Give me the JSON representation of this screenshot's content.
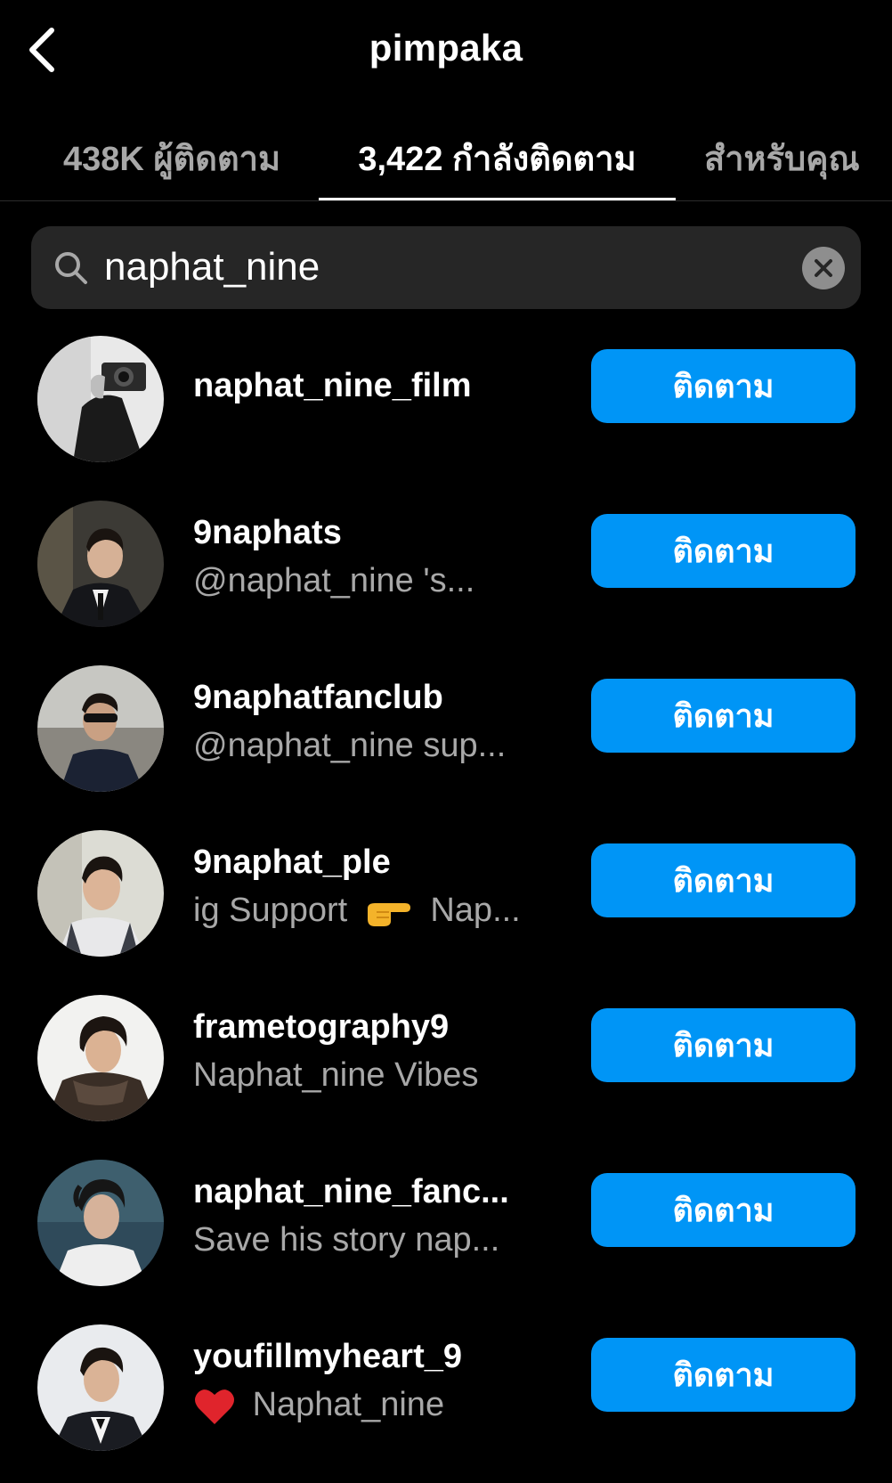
{
  "header": {
    "title": "pimpaka",
    "back_icon": "chevron-left-icon"
  },
  "tabs": [
    {
      "label": "438K ผู้ติดตาม",
      "active": false
    },
    {
      "label": "3,422 กำลังติดตาม",
      "active": true
    },
    {
      "label": "สำหรับคุณ",
      "active": false
    }
  ],
  "search": {
    "value": "naphat_nine",
    "icon": "search-icon",
    "clear_icon": "clear-icon"
  },
  "results": [
    {
      "username": "naphat_nine_film",
      "subtitle": "",
      "button": "ติดตาม"
    },
    {
      "username": "9naphats",
      "subtitle": "@naphat_nine 's...",
      "button": "ติดตาม"
    },
    {
      "username": "9naphatfanclub",
      "subtitle": "@naphat_nine sup...",
      "button": "ติดตาม"
    },
    {
      "username": "9naphat_ple",
      "subtitle_prefix": "ig Support",
      "subtitle_emoji": "pointing-right-hand-icon",
      "subtitle_suffix": "Nap...",
      "button": "ติดตาม"
    },
    {
      "username": "frametography9",
      "subtitle": "Naphat_nine Vibes",
      "button": "ติดตาม"
    },
    {
      "username": "naphat_nine_fanc...",
      "subtitle": "Save his story nap...",
      "button": "ติดตาม"
    },
    {
      "username": "youfillmyheart_9",
      "subtitle_emoji": "red-heart-icon",
      "subtitle_suffix": "Naphat_nine",
      "button": "ติดตาม"
    }
  ],
  "colors": {
    "background": "#000000",
    "button_blue": "#0095f6",
    "secondary_text": "#a8a8a8",
    "search_bg": "#262626"
  }
}
